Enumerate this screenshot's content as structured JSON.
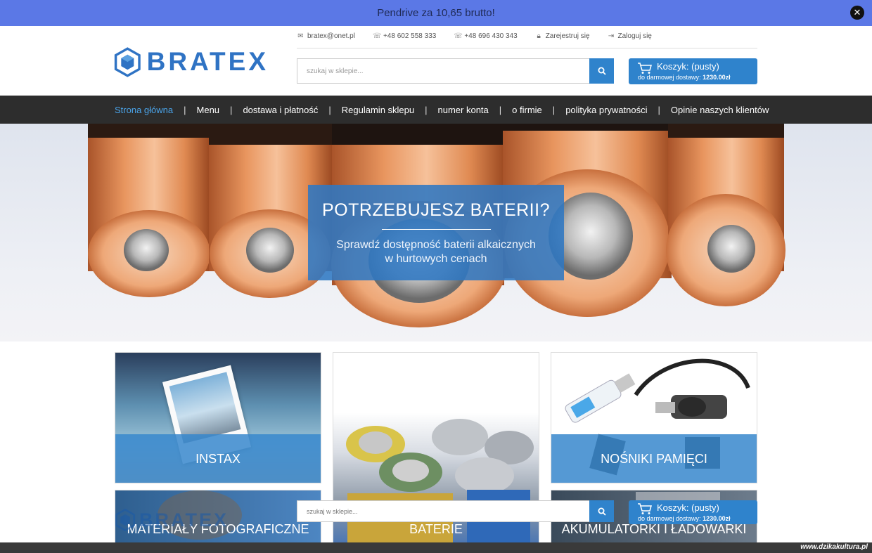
{
  "promo": {
    "text": "Pendrive za 10,65 brutto!"
  },
  "header": {
    "logo_text": "BRATEX",
    "email": "bratex@onet.pl",
    "phone1": "+48 602 558 333",
    "phone2": "+48 696 430 343",
    "register": "Zarejestruj się",
    "login": "Zaloguj się",
    "search_placeholder": "szukaj w sklepie...",
    "cart_title": "Koszyk: (pusty)",
    "cart_free_label": "do darmowej dostawy:",
    "cart_free_amount": "1230.00zł"
  },
  "nav": {
    "items": [
      "Strona główna",
      "Menu",
      "dostawa i płatność",
      "Regulamin sklepu",
      "numer konta",
      "o firmie",
      "polityka prywatności",
      "Opinie naszych klientów"
    ],
    "separator": "|"
  },
  "hero": {
    "title": "POTRZEBUJESZ BATERII?",
    "subtitle_line1": "Sprawdź dostępność baterii alkaicznych",
    "subtitle_line2": "w hurtowych cenach"
  },
  "tiles": [
    {
      "label": "INSTAX"
    },
    {
      "label": "NOŚNIKI PAMIĘCI"
    },
    {
      "label": "MATERIAŁY FOTOGRAFICZNE"
    },
    {
      "label": "BATERIE"
    },
    {
      "label": "AKUMULATORKI I ŁADOWARKI"
    }
  ],
  "watermark": "www.dzikakultura.pl",
  "colors": {
    "accent": "#2f83cc",
    "promo_bg": "#5b78e6",
    "nav_bg": "#2d2d2d",
    "nav_active": "#4aa3e8"
  },
  "icons": [
    "close-icon",
    "envelope-icon",
    "headset-icon",
    "lock-icon",
    "login-icon",
    "search-icon",
    "cart-icon"
  ]
}
